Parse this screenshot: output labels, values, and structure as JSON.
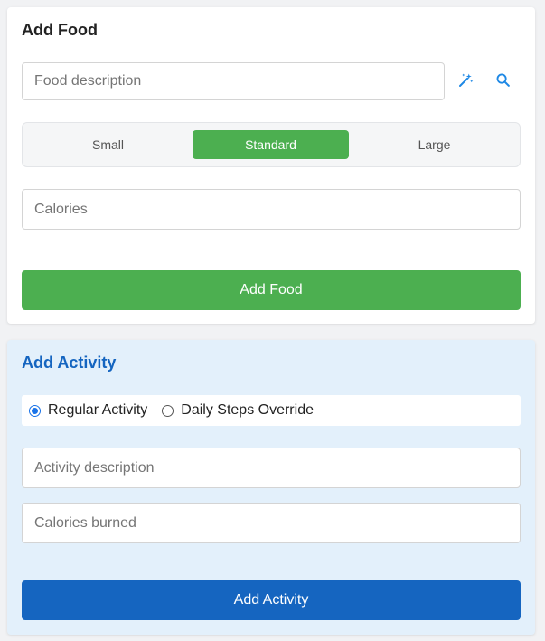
{
  "food": {
    "title": "Add Food",
    "description_placeholder": "Food description",
    "magic_icon": "magic-wand-icon",
    "search_icon": "search-icon",
    "portion_options": [
      "Small",
      "Standard",
      "Large"
    ],
    "portion_selected": "Standard",
    "calories_placeholder": "Calories",
    "submit_label": "Add Food",
    "accent_color": "#4caf50"
  },
  "activity": {
    "title": "Add Activity",
    "mode_options": [
      "Regular Activity",
      "Daily Steps Override"
    ],
    "mode_selected": "Regular Activity",
    "description_placeholder": "Activity description",
    "calories_placeholder": "Calories burned",
    "submit_label": "Add Activity",
    "accent_color": "#1565c0",
    "background_color": "#e3f0fb"
  }
}
